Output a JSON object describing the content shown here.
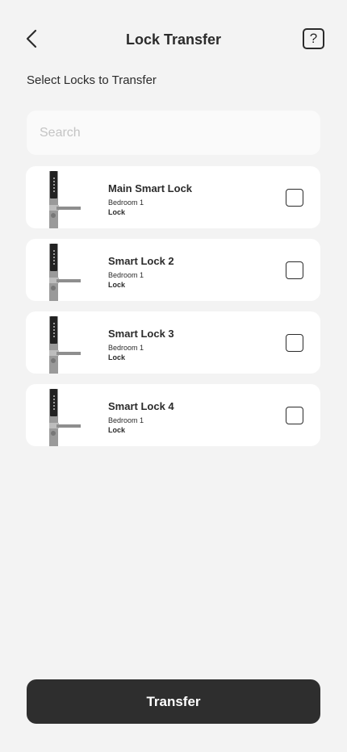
{
  "header": {
    "title": "Lock Transfer",
    "back_icon": "chevron-left-icon",
    "help_label": "?"
  },
  "subtitle": "Select Locks to Transfer",
  "search": {
    "placeholder": "Search",
    "value": ""
  },
  "locks": [
    {
      "name": "Main Smart Lock",
      "room": "Bedroom 1",
      "type": "Lock",
      "checked": false
    },
    {
      "name": "Smart Lock 2",
      "room": "Bedroom 1",
      "type": "Lock",
      "checked": false
    },
    {
      "name": "Smart Lock 3",
      "room": "Bedroom 1",
      "type": "Lock",
      "checked": false
    },
    {
      "name": "Smart Lock 4",
      "room": "Bedroom 1",
      "type": "Lock",
      "checked": false
    }
  ],
  "footer": {
    "transfer_label": "Transfer"
  },
  "colors": {
    "background": "#f3f3f3",
    "card": "#ffffff",
    "primary": "#2e2e2e",
    "placeholder": "#c4c4c4"
  }
}
